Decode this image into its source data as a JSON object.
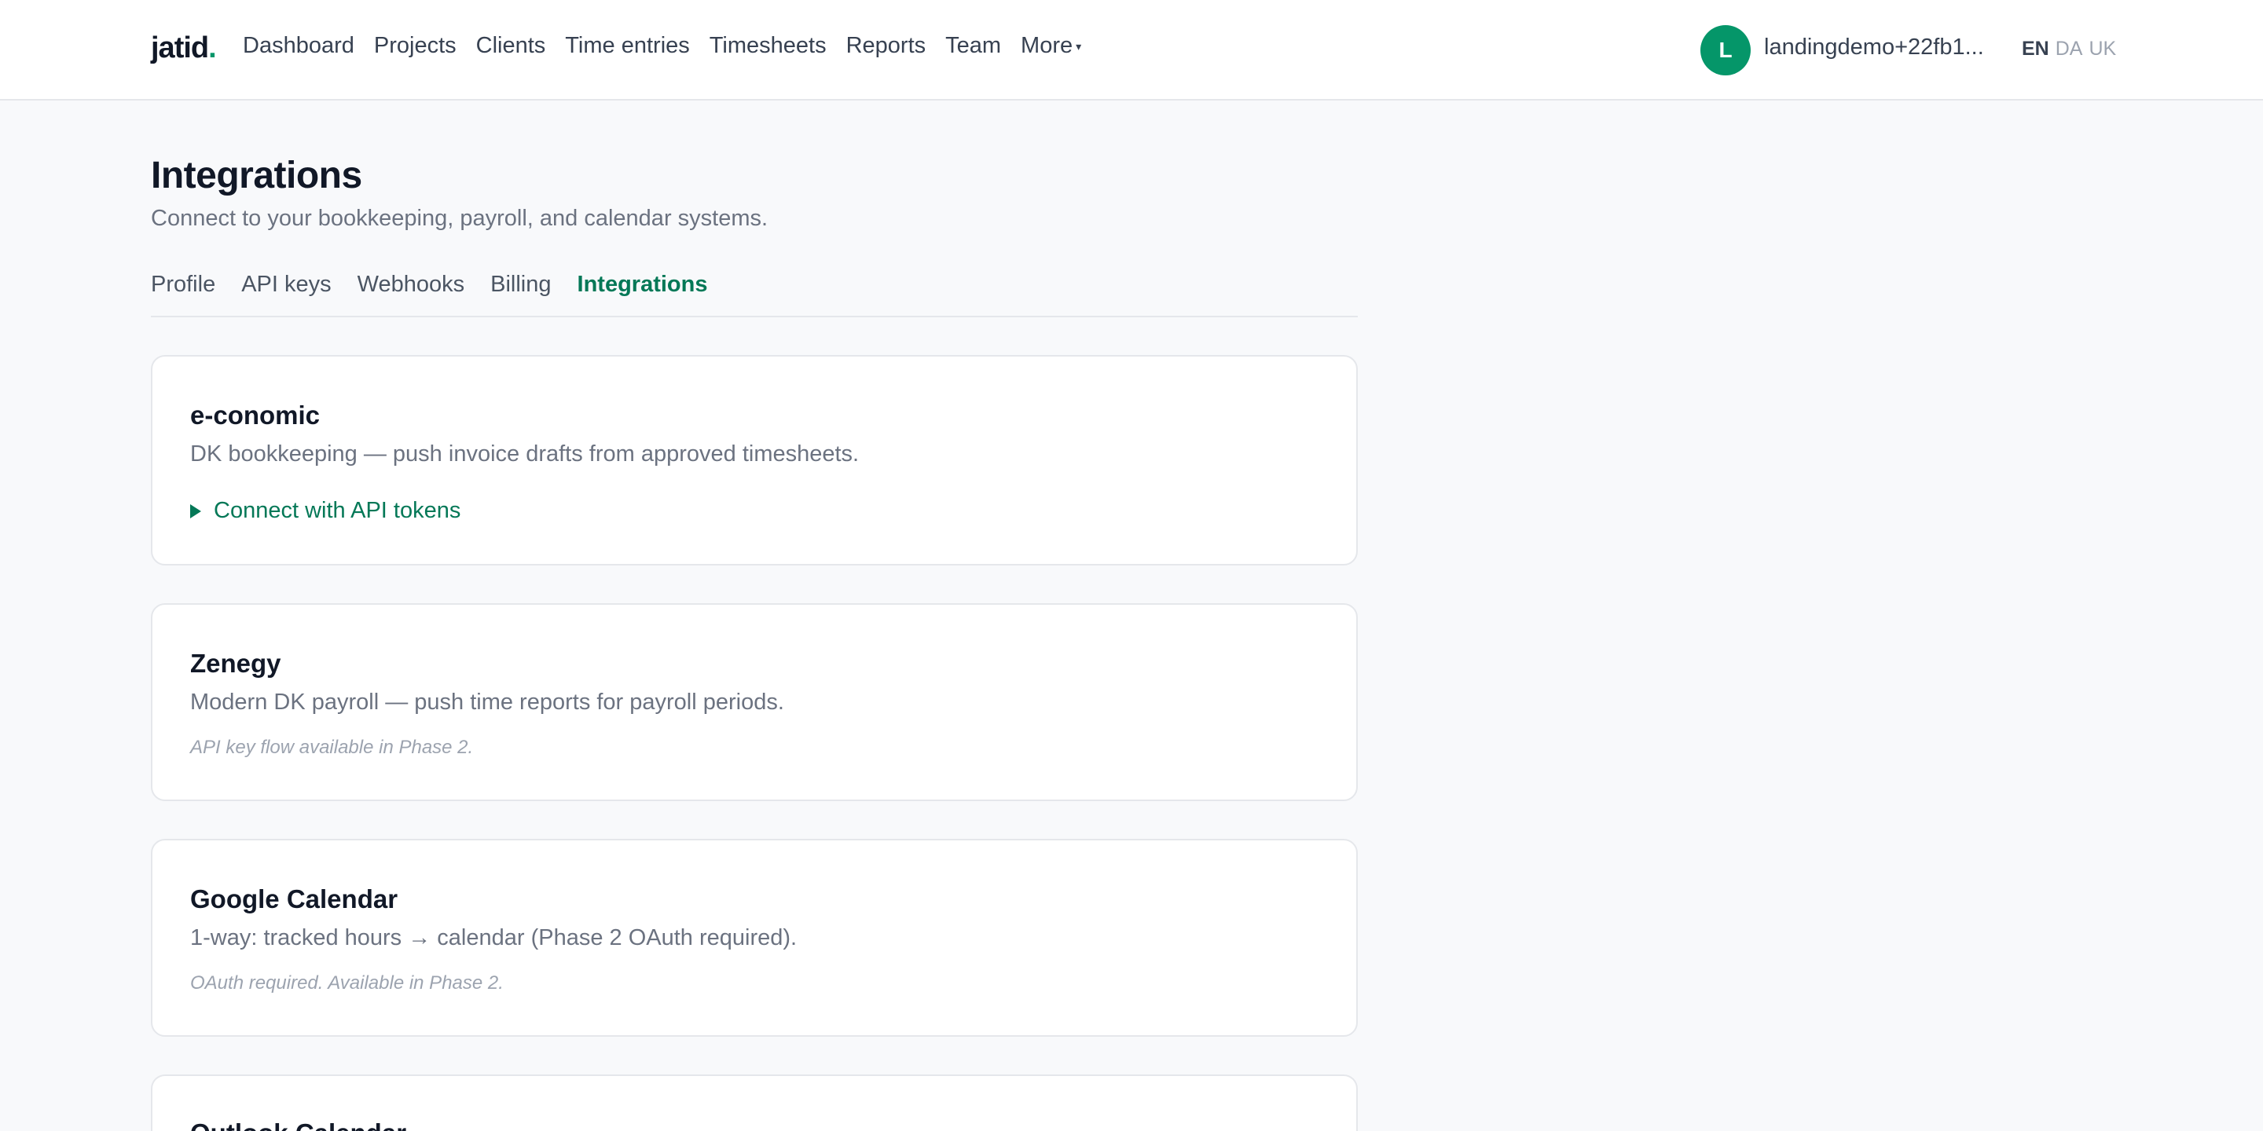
{
  "header": {
    "logo_text": "jatid",
    "logo_dot": ".",
    "nav": [
      {
        "label": "Dashboard"
      },
      {
        "label": "Projects"
      },
      {
        "label": "Clients"
      },
      {
        "label": "Time entries"
      },
      {
        "label": "Timesheets"
      },
      {
        "label": "Reports"
      },
      {
        "label": "Team"
      },
      {
        "label": "More"
      }
    ],
    "more_caret": "▾",
    "avatar_initial": "L",
    "username": "landingdemo+22fb1...",
    "languages": [
      "EN",
      "DA",
      "UK"
    ],
    "active_language": "EN"
  },
  "page": {
    "title": "Integrations",
    "subtitle": "Connect to your bookkeeping, payroll, and calendar systems."
  },
  "tabs": [
    {
      "label": "Profile"
    },
    {
      "label": "API keys"
    },
    {
      "label": "Webhooks"
    },
    {
      "label": "Billing"
    },
    {
      "label": "Integrations"
    }
  ],
  "active_tab": "Integrations",
  "integrations": [
    {
      "name": "e-conomic",
      "description": "DK bookkeeping — push invoice drafts from approved timesheets.",
      "action_label": "Connect with API tokens"
    },
    {
      "name": "Zenegy",
      "description": "Modern DK payroll — push time reports for payroll periods.",
      "note": "API key flow available in Phase 2."
    },
    {
      "name": "Google Calendar",
      "description": "1-way: tracked hours → calendar (Phase 2 OAuth required).",
      "note": "OAuth required. Available in Phase 2."
    },
    {
      "name": "Outlook Calendar"
    }
  ],
  "colors": {
    "accent": "#059669",
    "accent_text": "#047857",
    "background": "#f8f9fb"
  }
}
